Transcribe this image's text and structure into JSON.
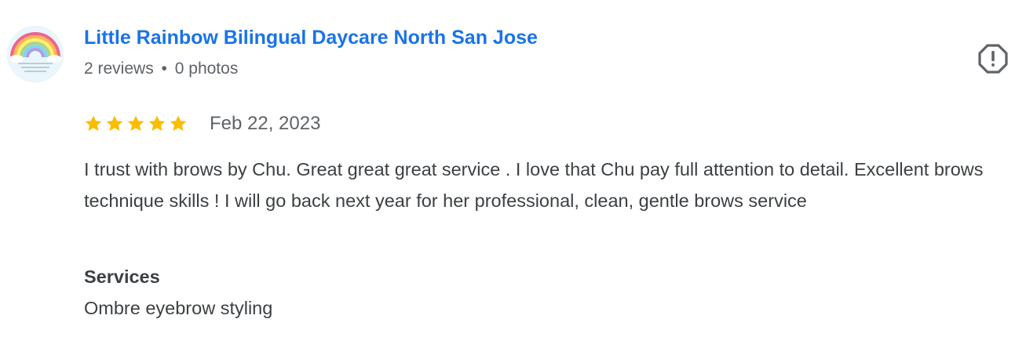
{
  "reviewer": {
    "name": "Little Rainbow Bilingual Daycare North San Jose",
    "reviews_count": "2 reviews",
    "separator": "•",
    "photos_count": "0 photos",
    "avatar_icon": "rainbow-logo"
  },
  "report": {
    "icon": "report-octagon-icon"
  },
  "review": {
    "rating": 5,
    "max_rating": 5,
    "star_color": "#fbbc04",
    "date": "Feb 22, 2023",
    "text": "I trust with brows by Chu. Great great great service . I love that Chu pay full attention to detail. Excellent brows technique skills ! I will go back next year for her professional, clean, gentle brows service"
  },
  "services": {
    "heading": "Services",
    "value": "Ombre eyebrow styling"
  },
  "colors": {
    "link": "#1a73e8",
    "secondary_text": "#5f6368",
    "body_text": "#3c4043"
  }
}
